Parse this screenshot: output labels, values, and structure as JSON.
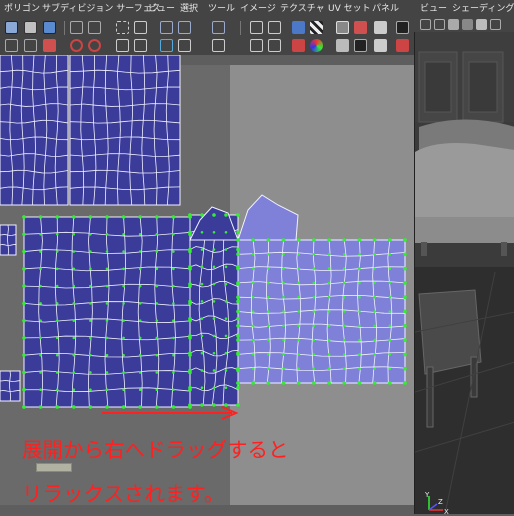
{
  "menubar": {
    "items": [
      "ポリゴン",
      "サブディビジョン サーフェス",
      "ビュー",
      "選択",
      "ツール",
      "イメージ",
      "テクスチャ",
      "UV セット",
      "パネル"
    ]
  },
  "viewport_menubar": {
    "items": [
      "ビュー",
      "シェーディング"
    ]
  },
  "annotation": {
    "line1": "展開から右へドラッグすると",
    "line2": "リラックスされます。",
    "color": "#ff2020"
  },
  "colors": {
    "uv_shell_fill": "#3b3b9a",
    "uv_shell_fill_selected": "#7f80d8",
    "uv_edge": "#f2f2ff",
    "uv_vertex": "#33ee33",
    "arrow": "#ff2020"
  },
  "icons": [
    "grid-icon",
    "move-icon",
    "rotate-icon",
    "scale-icon",
    "flip-icon",
    "unfold-icon",
    "relax-icon",
    "layout-icon",
    "snapshot-icon",
    "checker-icon",
    "shaded-icon",
    "image-icon"
  ],
  "viewport_axes": {
    "x": "X",
    "y": "Y",
    "z": "Z"
  }
}
